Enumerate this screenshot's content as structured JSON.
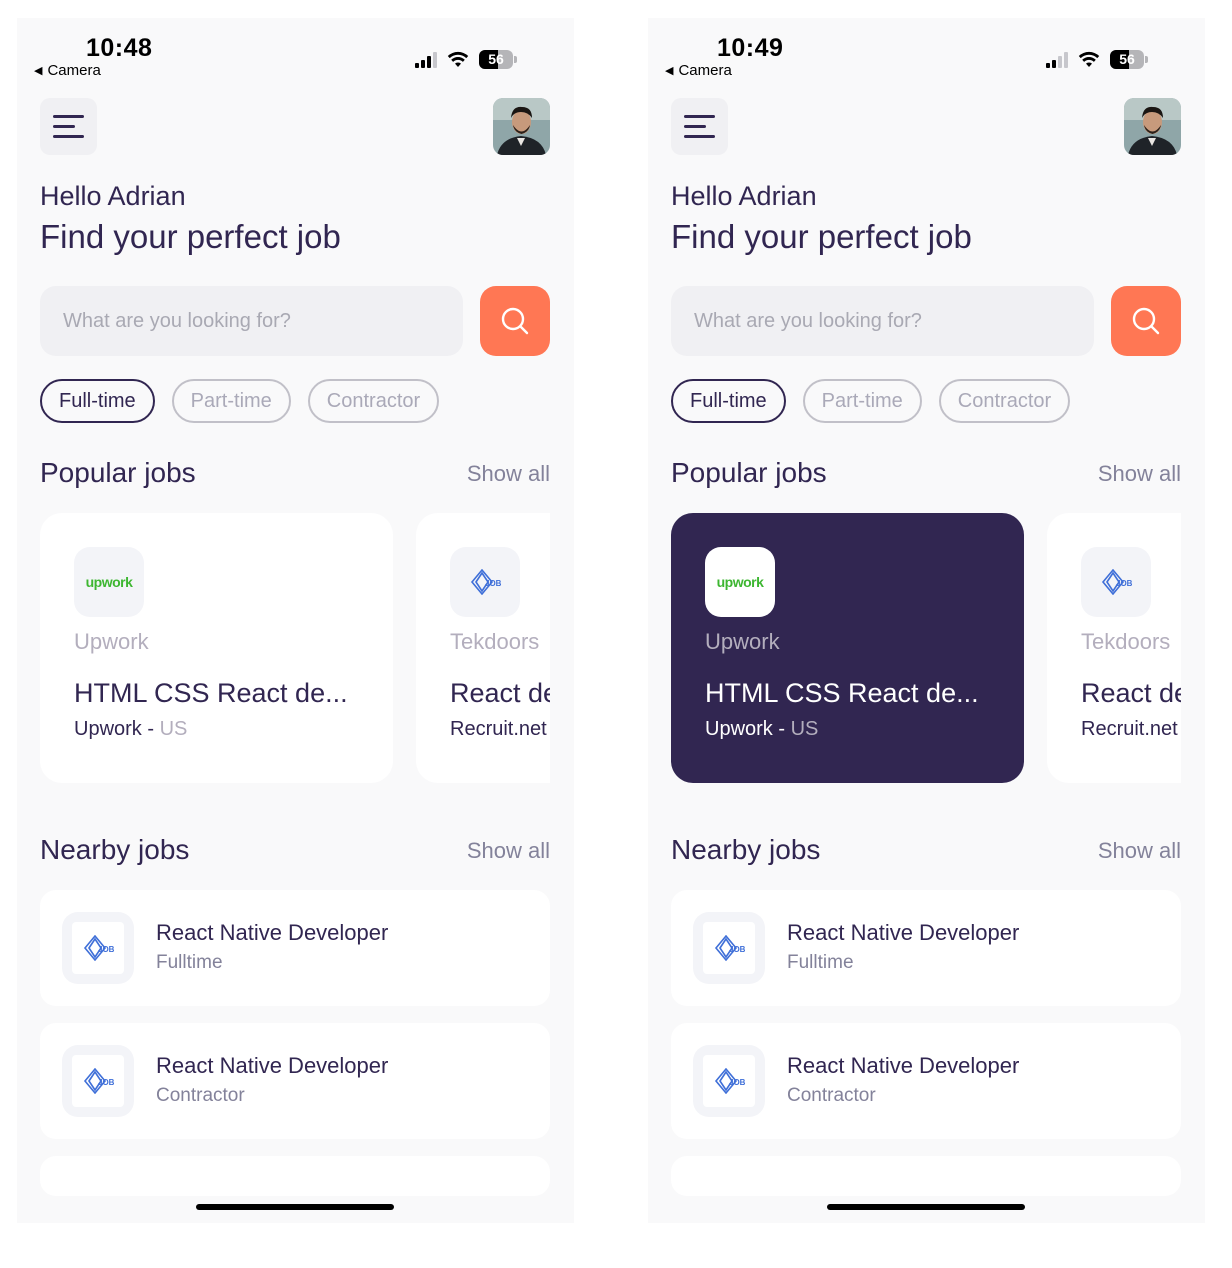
{
  "screens": [
    {
      "status": {
        "time": "10:48",
        "back_app": "Camera",
        "battery": "56"
      },
      "greeting": "Hello Adrian",
      "headline": "Find your perfect job",
      "search": {
        "placeholder": "What are you looking for?"
      },
      "chips": [
        "Full-time",
        "Part-time",
        "Contractor"
      ],
      "popular": {
        "title": "Popular jobs",
        "show_all": "Show all",
        "selected_index": -1,
        "cards": [
          {
            "company": "Upwork",
            "title": "HTML CSS React de...",
            "publisher": "Upwork",
            "separator": " - ",
            "location": "US",
            "logo_text": "upwork"
          },
          {
            "company": "Tekdoors",
            "title": "React de",
            "publisher": "Recruit.net",
            "separator": "",
            "location": ""
          }
        ]
      },
      "nearby": {
        "title": "Nearby jobs",
        "show_all": "Show all",
        "items": [
          {
            "title": "React Native Developer",
            "type": "Fulltime"
          },
          {
            "title": "React Native Developer",
            "type": "Contractor"
          }
        ]
      }
    },
    {
      "status": {
        "time": "10:49",
        "back_app": "Camera",
        "battery": "56"
      },
      "greeting": "Hello Adrian",
      "headline": "Find your perfect job",
      "search": {
        "placeholder": "What are you looking for?"
      },
      "chips": [
        "Full-time",
        "Part-time",
        "Contractor"
      ],
      "popular": {
        "title": "Popular jobs",
        "show_all": "Show all",
        "selected_index": 0,
        "cards": [
          {
            "company": "Upwork",
            "title": "HTML CSS React de...",
            "publisher": "Upwork",
            "separator": " - ",
            "location": "US",
            "logo_text": "upwork"
          },
          {
            "company": "Tekdoors",
            "title": "React de",
            "publisher": "Recruit.net",
            "separator": "",
            "location": ""
          }
        ]
      },
      "nearby": {
        "title": "Nearby jobs",
        "show_all": "Show all",
        "items": [
          {
            "title": "React Native Developer",
            "type": "Fulltime"
          },
          {
            "title": "React Native Developer",
            "type": "Contractor"
          }
        ]
      }
    }
  ],
  "colors": {
    "primary": "#312651",
    "accent": "#ff7754",
    "gray": "#83829a",
    "upwork_green": "#3db631",
    "job_logo_blue": "#3f6fd8"
  }
}
